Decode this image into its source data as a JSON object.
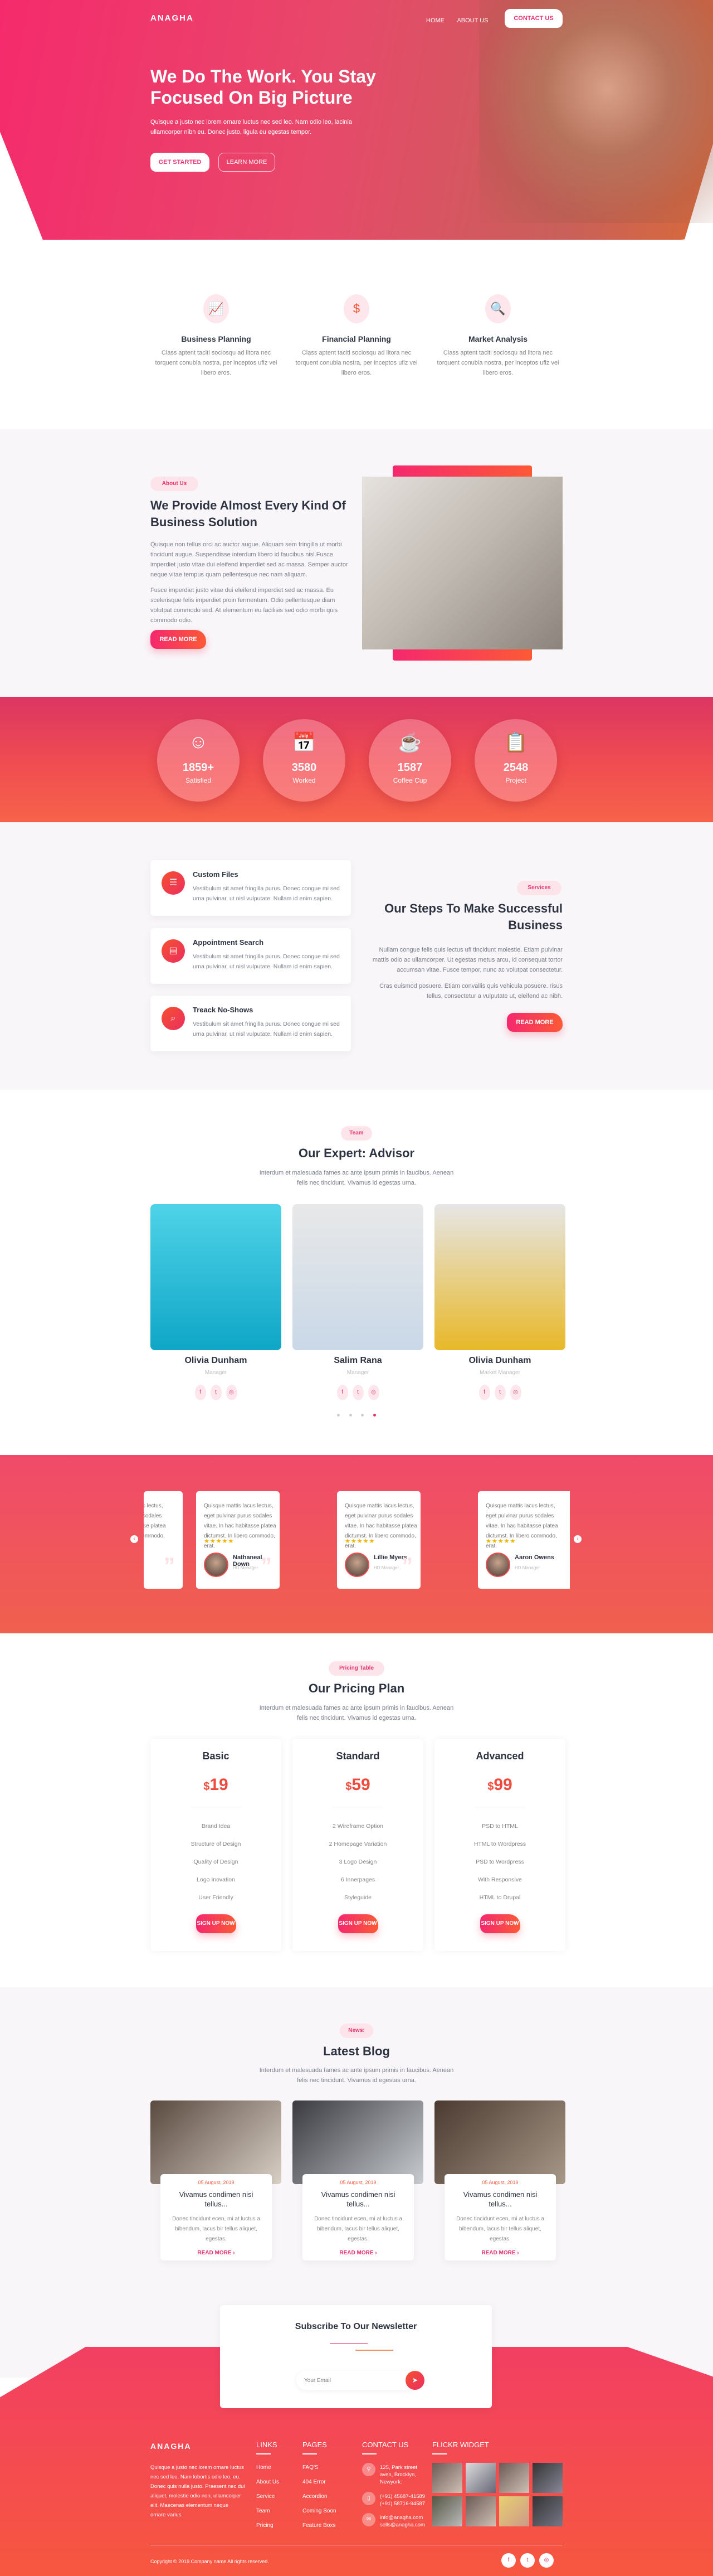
{
  "nav": {
    "logo": "ANAGHA",
    "home": "HOME",
    "about": "ABOUT US",
    "contact": "CONTACT US"
  },
  "hero": {
    "title": "We Do The Work. You Stay Focused On Big Picture",
    "text": "Quisque a justo nec lorem ornare luctus nec sed leo. Nam odio leo, lacinia ullamcorper nibh eu. Donec justo, ligula eu egestas tempor.",
    "get_started": "GET STARTED",
    "learn_more": "LEARN MORE"
  },
  "features": [
    {
      "icon": "chart-growth-icon",
      "title": "Business Planning",
      "text": "Class aptent taciti sociosqu ad litora nec torquent conubia nostra, per inceptos ufiz vel libero eros."
    },
    {
      "icon": "hand-dollar-icon",
      "title": "Financial Planning",
      "text": "Class aptent taciti sociosqu ad litora nec torquent conubia nostra, per inceptos ufiz vel libero eros."
    },
    {
      "icon": "search-dollar-icon",
      "title": "Market Analysis",
      "text": "Class aptent taciti sociosqu ad litora nec torquent conubia nostra, per inceptos ufiz vel libero eros."
    }
  ],
  "about": {
    "pill": "About Us",
    "title": "We Provide Almost Every Kind Of Business Solution",
    "p1": "Quisque non tellus orci ac auctor augue. Aliquam sem fringilla ut morbi tincidunt augue. Suspendisse interdum libero id faucibus nisl.Fusce imperdiet justo vitae dui eleifend imperdiet sed ac massa. Semper auctor neque vitae tempus quam pellentesque nec nam aliquam.",
    "p2": "Fusce imperdiet justo vitae dui eleifend imperdiet sed ac massa. Eu scelerisque felis imperdiet proin fermentum. Odio pellentesque diam volutpat commodo sed. At elementum eu facilisis sed odio morbi quis commodo odio.",
    "button": "READ MORE"
  },
  "stats": [
    {
      "icon": "smile-icon",
      "value": "1859+",
      "label": "Satisfied"
    },
    {
      "icon": "calendar-icon",
      "value": "3580",
      "label": "Worked"
    },
    {
      "icon": "coffee-cup-icon",
      "value": "1587",
      "label": "Coffee Cup"
    },
    {
      "icon": "checklist-icon",
      "value": "2548",
      "label": "Project"
    }
  ],
  "services": {
    "pill": "Services",
    "title": "Our Steps To Make Successful Business",
    "p1": "Nullam congue felis quis lectus ufi tincidunt molestie. Etiam pulvinar mattis odio ac ullamcorper. Ut egestas metus arcu, id consequat tortor accumsan vitae. Fusce tempor, nunc ac volutpat consectetur.",
    "p2": "Cras euismod posuere. Etiam convallis quis vehicula posuere. risus tellus, consectetur a vulputate ut, eleifend ac nibh.",
    "button": "READ MORE",
    "items": [
      {
        "icon": "files-icon",
        "title": "Custom Files",
        "text": "Vestibulum sit amet fringilla purus. Donec congue mi sed urna pulvinar, ut nisl vulputate. Nullam id enim sapien."
      },
      {
        "icon": "document-icon",
        "title": "Appointment Search",
        "text": "Vestibulum sit amet fringilla purus. Donec congue mi sed urna pulvinar, ut nisl vulputate. Nullam id enim sapien."
      },
      {
        "icon": "magnifier-icon",
        "title": "Treack No-Shows",
        "text": "Vestibulum sit amet fringilla purus. Donec congue mi sed urna pulvinar, ut nisl vulputate. Nullam id enim sapien."
      }
    ]
  },
  "team": {
    "pill": "Team",
    "title": "Our Expert: Advisor",
    "text": "Interdum et malesuada fames ac ante ipsum primis in faucibus. Aenean felis nec tincidunt. Vivamus id egestas urna.",
    "members": [
      {
        "name": "Olivia Dunham",
        "role": "Manager"
      },
      {
        "name": "Salim Rana",
        "role": "Manager"
      },
      {
        "name": "Olivia Dunham",
        "role": "Market Manager"
      }
    ],
    "active_dot": 4,
    "dot_count": 4
  },
  "testimonials": [
    {
      "text": "Quisque mattis lacus lectus, eget pulvinar purus sodales vitae. In hac habitasse platea dictumst. In libero commodo, erat.",
      "stars": "★★★★★",
      "name": "",
      "role": ""
    },
    {
      "text": "Quisque mattis lacus lectus, eget pulvinar purus sodales vitae. In hac habitasse platea dictumst. In libero commodo, erat.",
      "stars": "★★★★★",
      "name": "Nathaneal Down",
      "role": "HD Manager"
    },
    {
      "text": "Quisque mattis lacus lectus, eget pulvinar purus sodales vitae. In hac habitasse platea dictumst. In libero commodo, erat.",
      "stars": "★★★★★",
      "name": "Lillie Myers",
      "role": "HD Manager"
    },
    {
      "text": "Quisque mattis lacus lectus, eget pulvinar purus sodales vitae. In hac habitasse platea dictumst. In libero commodo, erat.",
      "stars": "★★★★★",
      "name": "Aaron Owens",
      "role": "HD Manager"
    }
  ],
  "pricing": {
    "pill": "Pricing Table",
    "title": "Our Pricing Plan",
    "text": "Interdum et malesuada fames ac ante ipsum primis in faucibus. Aenean felis nec tincidunt. Vivamus id egestas urna.",
    "plans": [
      {
        "name": "Basic",
        "currency": "$",
        "price": "19",
        "features": [
          "Brand Idea",
          "Structure of Design",
          "Quality of Design",
          "Logo Inovation",
          "User Friendly"
        ],
        "button": "SIGN UP NOW"
      },
      {
        "name": "Standard",
        "currency": "$",
        "price": "59",
        "features": [
          "2 Wireframe Option",
          "2 Homepage Variation",
          "3 Logo Design",
          "6 Innerpages",
          "Styleguide"
        ],
        "button": "SIGN UP NOW"
      },
      {
        "name": "Advanced",
        "currency": "$",
        "price": "99",
        "features": [
          "PSD to HTML",
          "HTML to Wordpress",
          "PSD to Wordpress",
          "With Responsive",
          "HTML to Drupal"
        ],
        "button": "SIGN UP NOW"
      }
    ]
  },
  "blog": {
    "pill": "News:",
    "title": "Latest Blog",
    "text": "Interdum et malesuada fames ac ante ipsum primis in faucibus. Aenean felis nec tincidunt. Vivamus id egestas urna.",
    "posts": [
      {
        "date": "05 August, 2019",
        "title": "Vivamus condimen nisi tellus...",
        "text": "Donec tincidunt ecen, mi at luctus a bibendum, lacus bir tellus aliquet, egestas.",
        "link": "READ MORE ›"
      },
      {
        "date": "05 August, 2019",
        "title": "Vivamus condimen nisi tellus...",
        "text": "Donec tincidunt ecen, mi at luctus a bibendum, lacus bir tellus aliquet, egestas.",
        "link": "READ MORE ›"
      },
      {
        "date": "05 August, 2019",
        "title": "Vivamus condimen nisi tellus...",
        "text": "Donec tincidunt ecen, mi at luctus a bibendum, lacus bir tellus aliquet, egestas.",
        "link": "READ MORE ›"
      }
    ]
  },
  "newsletter": {
    "title": "Subscribe To Our Newsletter",
    "placeholder": "Your Email"
  },
  "footer": {
    "logo": "ANAGHA",
    "about": "Quisque a justo nec lorem ornare luctus nec sed leo. Nam lobortis odio leo, eu. Donec quis nulla justo. Praesent nec dui aliquet, molestie odio non, ullamcorper elit. Maecenas elementum neque ornare varius.",
    "links_title": "LINKS",
    "links": [
      "Home",
      "About Us",
      "Service",
      "Team",
      "Pricing"
    ],
    "pages_title": "PAGES",
    "pages": [
      "FAQ'S",
      "404 Error",
      "Accordion",
      "Coming Soon",
      "Feature Boxs"
    ],
    "contact_title": "CONTACT US",
    "address": "125, Park street aven, Brocklyn, Newyork.",
    "phone1": "(+91) 45687-41589",
    "phone2": "(+91) 58716-94587",
    "email1": "info@anagha.com",
    "email2": "sells@anagha.com",
    "flickr_title": "FLICKR WIDGET",
    "copyright": "Copyright © 2019.Company name All rights reserved."
  },
  "colors": {
    "accent_pink": "#f5286e",
    "accent_orange": "#fc5a36",
    "text_dark": "#2d3340"
  }
}
